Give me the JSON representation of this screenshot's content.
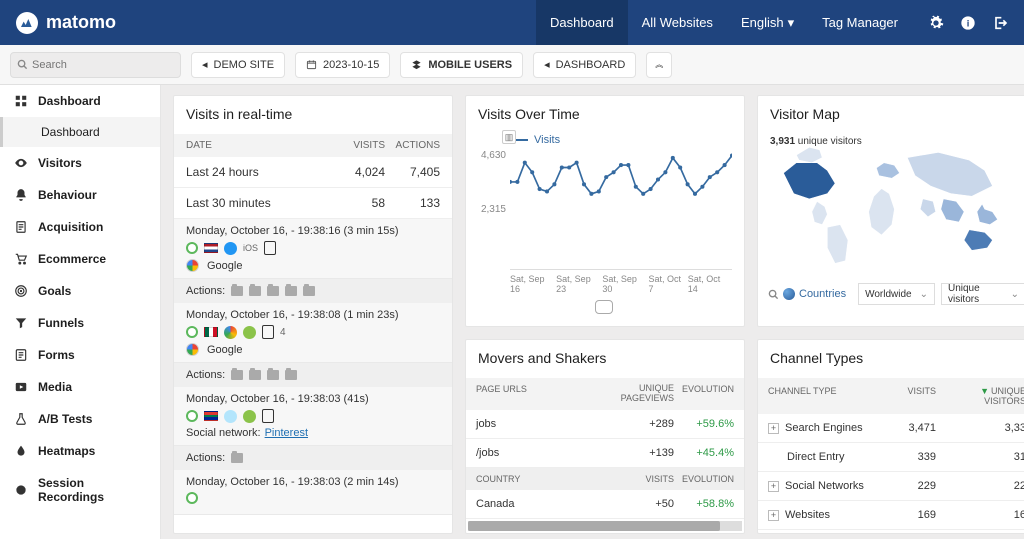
{
  "brand": "matomo",
  "topnav": {
    "dashboard": "Dashboard",
    "all_websites": "All Websites",
    "language": "English",
    "tag_manager": "Tag Manager"
  },
  "search_placeholder": "Search",
  "pills": {
    "site": "DEMO SITE",
    "date": "2023-10-15",
    "segment": "MOBILE USERS",
    "dashboard": "DASHBOARD"
  },
  "sidebar": [
    {
      "label": "Dashboard",
      "icon": "grid",
      "strong": true,
      "sub": "Dashboard"
    },
    {
      "label": "Visitors",
      "icon": "eye",
      "strong": true
    },
    {
      "label": "Behaviour",
      "icon": "bell",
      "strong": true
    },
    {
      "label": "Acquisition",
      "icon": "doc",
      "strong": true
    },
    {
      "label": "Ecommerce",
      "icon": "cart",
      "strong": true
    },
    {
      "label": "Goals",
      "icon": "target",
      "strong": true
    },
    {
      "label": "Funnels",
      "icon": "funnel",
      "strong": true
    },
    {
      "label": "Forms",
      "icon": "form",
      "strong": true
    },
    {
      "label": "Media",
      "icon": "media",
      "strong": true
    },
    {
      "label": "A/B Tests",
      "icon": "flask",
      "strong": true
    },
    {
      "label": "Heatmaps",
      "icon": "drop",
      "strong": true
    },
    {
      "label": "Session Recordings",
      "icon": "rec",
      "strong": true
    }
  ],
  "realtime": {
    "title": "Visits in real-time",
    "headers": [
      "DATE",
      "VISITS",
      "ACTIONS"
    ],
    "summary": [
      {
        "label": "Last 24 hours",
        "visits": "4,024",
        "actions": "7,405"
      },
      {
        "label": "Last 30 minutes",
        "visits": "58",
        "actions": "133"
      }
    ],
    "actions_label": "Actions:",
    "ref_google": "Google",
    "ref_social_label": "Social network:",
    "ref_social_value": "Pinterest",
    "visits": [
      {
        "time": "Monday, October 16, - 19:38:16 (3 min 15s)",
        "flag": "nl",
        "ref": "google",
        "folders": 5
      },
      {
        "time": "Monday, October 16, - 19:38:08 (1 min 23s)",
        "flag": "mx",
        "ref": "google",
        "extra": "4",
        "folders": 4
      },
      {
        "time": "Monday, October 16, - 19:38:03 (41s)",
        "flag": "za",
        "ref": "pinterest",
        "folders": 1
      },
      {
        "time": "Monday, October 16, - 19:38:03 (2 min 14s)",
        "flag": "",
        "ref": "",
        "folders": 0
      }
    ]
  },
  "visits_over_time": {
    "title": "Visits Over Time",
    "legend": "Visits",
    "y_top": "4,630",
    "y_mid": "2,315",
    "x": [
      "Sat, Sep 16",
      "Sat, Sep 23",
      "Sat, Sep 30",
      "Sat, Oct 7",
      "Sat, Oct 14"
    ]
  },
  "chart_data": {
    "type": "line",
    "title": "Visits Over Time",
    "series": [
      {
        "name": "Visits",
        "values": [
          3300,
          3300,
          4100,
          3700,
          3000,
          2900,
          3200,
          3900,
          3900,
          4100,
          3200,
          2800,
          2900,
          3500,
          3700,
          4000,
          4000,
          3100,
          2800,
          3000,
          3400,
          3700,
          4300,
          3900,
          3200,
          2800,
          3100,
          3500,
          3700,
          4000,
          4400
        ]
      }
    ],
    "x": [
      "Sep 16",
      "Sep 17",
      "Sep 18",
      "Sep 19",
      "Sep 20",
      "Sep 21",
      "Sep 22",
      "Sep 23",
      "Sep 24",
      "Sep 25",
      "Sep 26",
      "Sep 27",
      "Sep 28",
      "Sep 29",
      "Sep 30",
      "Oct 1",
      "Oct 2",
      "Oct 3",
      "Oct 4",
      "Oct 5",
      "Oct 6",
      "Oct 7",
      "Oct 8",
      "Oct 9",
      "Oct 10",
      "Oct 11",
      "Oct 12",
      "Oct 13",
      "Oct 14",
      "Oct 15",
      "Oct 16"
    ],
    "ylim": [
      0,
      4630
    ],
    "xlabel": "",
    "ylabel": "Visits"
  },
  "movers": {
    "title": "Movers and Shakers",
    "section1": {
      "head": [
        "PAGE URLS",
        "UNIQUE PAGEVIEWS",
        "EVOLUTION"
      ],
      "rows": [
        {
          "c1": "jobs",
          "c2": "+289",
          "c3": "+59.6%"
        },
        {
          "c1": "/jobs",
          "c2": "+139",
          "c3": "+45.4%"
        }
      ]
    },
    "section2": {
      "head": [
        "COUNTRY",
        "VISITS",
        "EVOLUTION"
      ],
      "rows": [
        {
          "c1": "Canada",
          "c2": "+50",
          "c3": "+58.8%"
        }
      ]
    }
  },
  "map": {
    "title": "Visitor Map",
    "caption_count": "3,931",
    "caption_rest": " unique visitors",
    "breadcrumb": "Countries",
    "sel1": "Worldwide",
    "sel2": "Unique visitors"
  },
  "channels": {
    "title": "Channel Types",
    "headers": [
      "CHANNEL TYPE",
      "VISITS",
      "UNIQUE VISITORS"
    ],
    "rows": [
      {
        "label": "Search Engines",
        "visits": "3,471",
        "unique": "3,33",
        "expand": true
      },
      {
        "label": "Direct Entry",
        "visits": "339",
        "unique": "31",
        "expand": false
      },
      {
        "label": "Social Networks",
        "visits": "229",
        "unique": "22",
        "expand": true
      },
      {
        "label": "Websites",
        "visits": "169",
        "unique": "16",
        "expand": true
      }
    ]
  }
}
